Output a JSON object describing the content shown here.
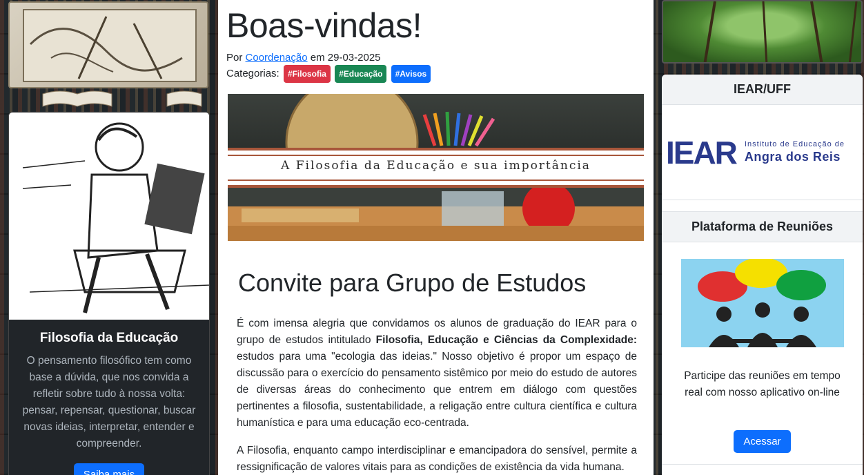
{
  "left": {
    "card_title": "Filosofia da Educação",
    "card_text": "O pensamento filosófico tem como base a dúvida, que nos convida a refletir sobre tudo à nossa volta: pensar, repensar, questionar, buscar novas ideias, interpretar, entender e compreender.",
    "card_button": "Saiba mais"
  },
  "post": {
    "title": "Boas-vindas!",
    "by_label": "Por",
    "author": "Coordenação",
    "date_label": "em 29-03-2025",
    "categories_label": "Categorias:",
    "tags": [
      {
        "label": "#Filosofia",
        "color": "#dc3545"
      },
      {
        "label": "#Educação",
        "color": "#198754"
      },
      {
        "label": "#Avisos",
        "color": "#0d6efd"
      }
    ],
    "hero_caption": "A Filosofia da Educação e sua importância",
    "section_title": "Convite para Grupo de Estudos",
    "p1_a": "É com imensa alegria que convidamos os alunos de graduação do IEAR para o grupo de estudos intitulado ",
    "p1_bold": "Filosofia, Educação e Ciências da Complexidade:",
    "p1_b": " estudos para uma \"ecologia das ideias.\" Nosso objetivo é propor um espaço de discussão para o exercício do pensamento sistêmico por meio do estudo de autores de diversas áreas do conhecimento que entrem em diálogo com questões pertinentes a filosofia, sustentabilidade, a religação entre cultura científica e cultura humanística e para uma educação eco-centrada.",
    "p2": "A Filosofia, enquanto campo interdisciplinar e emancipadora do sensível, permite a ressignificação de valores vitais para as condições de existência da vida humana."
  },
  "right": {
    "iear_title": "IEAR/UFF",
    "logo_mark": "IEAR",
    "logo_small": "Instituto de Educação de",
    "logo_big": "Angra dos Reis",
    "meeting_title": "Plataforma de Reuniões",
    "meeting_text": "Participe das reuniões em tempo real com nosso aplicativo on-line",
    "meeting_button": "Acessar"
  },
  "colors": {
    "primary": "#0d6efd",
    "dark_card": "#212529"
  }
}
